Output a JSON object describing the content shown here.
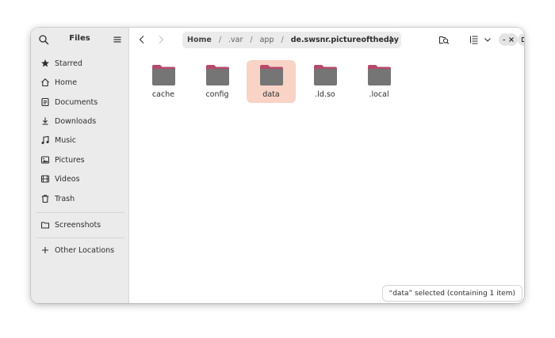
{
  "sidebar": {
    "title": "Files",
    "items": [
      {
        "label": "Starred",
        "icon": "star-icon"
      },
      {
        "label": "Home",
        "icon": "home-icon"
      },
      {
        "label": "Documents",
        "icon": "document-icon"
      },
      {
        "label": "Downloads",
        "icon": "download-icon"
      },
      {
        "label": "Music",
        "icon": "music-icon"
      },
      {
        "label": "Pictures",
        "icon": "picture-icon"
      },
      {
        "label": "Videos",
        "icon": "video-icon"
      },
      {
        "label": "Trash",
        "icon": "trash-icon"
      }
    ],
    "bookmarks": [
      {
        "label": "Screenshots",
        "icon": "folder-icon"
      }
    ],
    "other_locations": {
      "label": "Other Locations",
      "icon": "plus-icon"
    }
  },
  "path": {
    "crumbs": [
      "Home",
      ".var",
      "app",
      "de.swsnr.pictureoftheday"
    ]
  },
  "files": [
    {
      "name": "cache",
      "selected": false
    },
    {
      "name": "config",
      "selected": false
    },
    {
      "name": "data",
      "selected": true
    },
    {
      "name": ".ld.so",
      "selected": false
    },
    {
      "name": ".local",
      "selected": false
    }
  ],
  "status": {
    "text": "“data” selected  (containing 1 item)"
  },
  "colors": {
    "selection": "#f8d3c6",
    "folder_tab": "#b64a6b",
    "folder_body": "#757575"
  }
}
